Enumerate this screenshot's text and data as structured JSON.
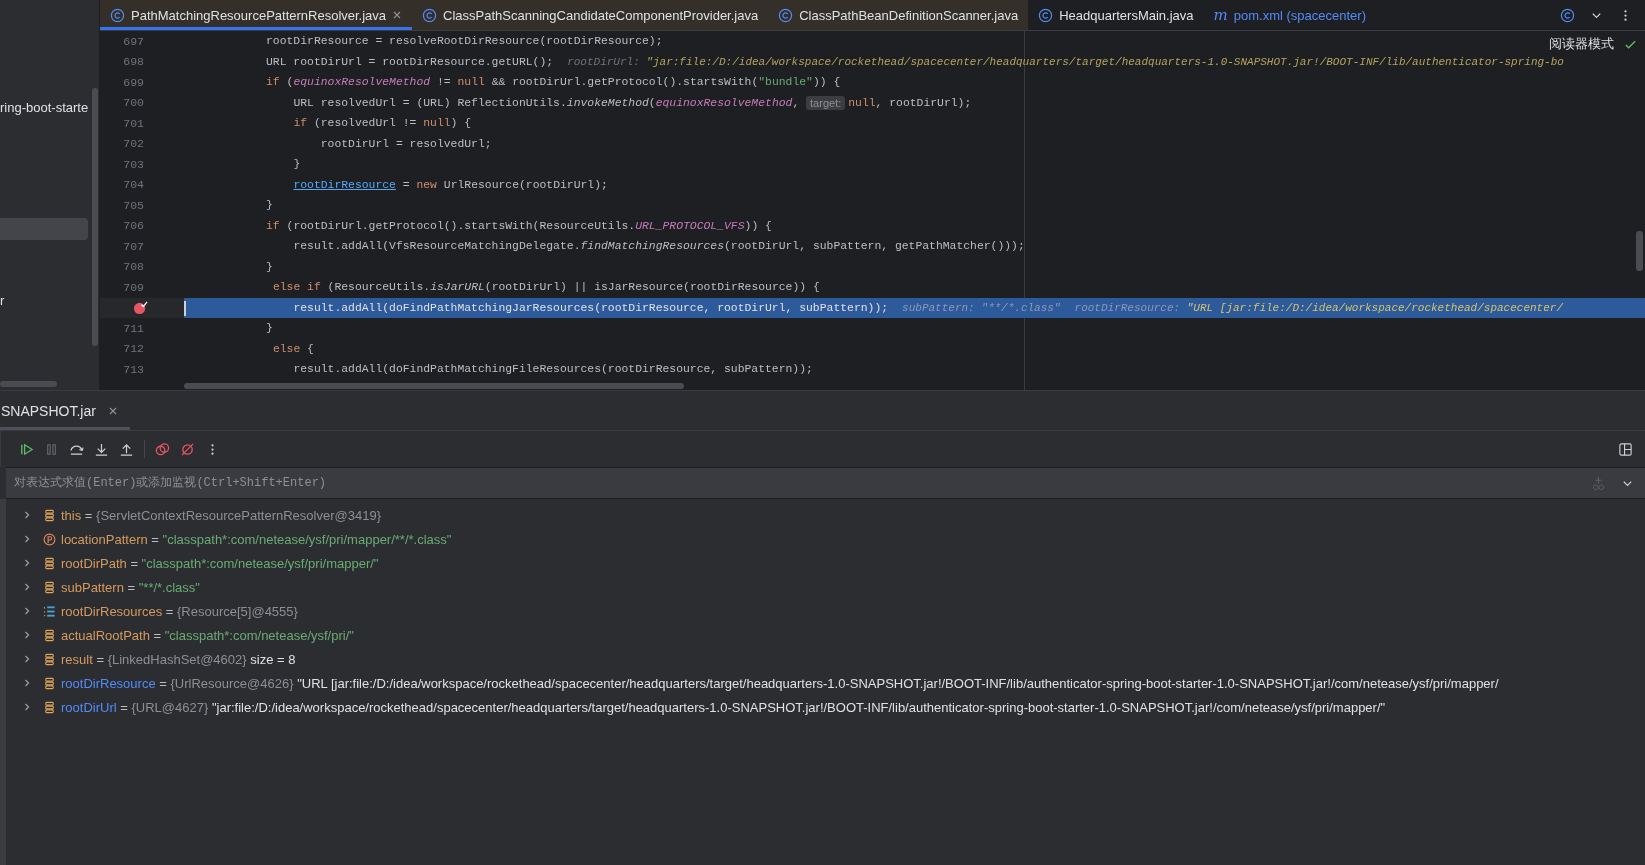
{
  "editor_tabs": [
    {
      "label": "PathMatchingResourcePatternResolver.java",
      "icon": {
        "kind": "class"
      },
      "selected": true,
      "tinted": true,
      "vcs_modified": false,
      "closable": true
    },
    {
      "label": "ClassPathScanningCandidateComponentProvider.java",
      "icon": {
        "kind": "class"
      },
      "selected": false,
      "tinted": true,
      "vcs_modified": false,
      "closable": false
    },
    {
      "label": "ClassPathBeanDefinitionScanner.java",
      "icon": {
        "kind": "class"
      },
      "selected": false,
      "tinted": true,
      "vcs_modified": false,
      "closable": false
    },
    {
      "label": "HeadquartersMain.java",
      "icon": {
        "kind": "class"
      },
      "selected": false,
      "tinted": false,
      "vcs_modified": false,
      "closable": false
    },
    {
      "label": "pom.xml (spacecenter)",
      "icon": {
        "kind": "glyph",
        "glyph": "m"
      },
      "selected": false,
      "tinted": false,
      "vcs_modified": true,
      "closable": false
    }
  ],
  "project_panel": {
    "items": [
      {
        "label": "ring-boot-starte",
        "selected": false
      },
      {
        "selected": true
      },
      {
        "label": "r",
        "selected": false
      }
    ]
  },
  "reader_mode": "阅读器模式",
  "code_lines": [
    {
      "number": "697",
      "segments": [
        {
          "kind": "code",
          "tokens": [
            {
              "kind": "plain",
              "text": "            rootDirResource = resolveRootDirResource(rootDirResource);"
            }
          ]
        }
      ]
    },
    {
      "number": "698",
      "segments": [
        {
          "kind": "code",
          "tokens": [
            {
              "kind": "plain",
              "text": "            URL rootDirUrl = rootDirResource.getURL();"
            }
          ]
        },
        {
          "kind": "value_hint",
          "name": "rootDirUrl:",
          "value": "\"jar:file:/D:/idea/workspace/rockethead/spacecenter/headquarters/target/headquarters-1.0-SNAPSHOT.jar!/BOOT-INF/lib/authenticator-spring-bo",
          "dim": false
        }
      ]
    },
    {
      "number": "699",
      "segments": [
        {
          "kind": "code",
          "tokens": [
            {
              "kind": "keyword",
              "text": "            if"
            },
            {
              "kind": "plain",
              "text": " ("
            },
            {
              "kind": "field",
              "text": "equinoxResolveMethod"
            },
            {
              "kind": "plain",
              "text": " != "
            },
            {
              "kind": "keyword",
              "text": "null"
            },
            {
              "kind": "plain",
              "text": " && rootDirUrl.getProtocol().startsWith("
            },
            {
              "kind": "string",
              "text": "\"bundle\""
            },
            {
              "kind": "plain",
              "text": ")) {"
            }
          ]
        }
      ]
    },
    {
      "number": "700",
      "segments": [
        {
          "kind": "code",
          "tokens": [
            {
              "kind": "plain",
              "text": "                URL resolvedUrl = (URL) ReflectionUtils."
            },
            {
              "kind": "static_call",
              "text": "invokeMethod"
            },
            {
              "kind": "plain",
              "text": "("
            },
            {
              "kind": "field",
              "text": "equinoxResolveMethod"
            },
            {
              "kind": "plain",
              "text": ", "
            }
          ]
        },
        {
          "kind": "param_hint",
          "text": "target:"
        },
        {
          "kind": "code",
          "tokens": [
            {
              "kind": "keyword",
              "text": "null"
            },
            {
              "kind": "plain",
              "text": ", rootDirUrl);"
            }
          ]
        }
      ]
    },
    {
      "number": "701",
      "segments": [
        {
          "kind": "code",
          "tokens": [
            {
              "kind": "keyword",
              "text": "                if"
            },
            {
              "kind": "plain",
              "text": " (resolvedUrl != "
            },
            {
              "kind": "keyword",
              "text": "null"
            },
            {
              "kind": "plain",
              "text": ") {"
            }
          ]
        }
      ]
    },
    {
      "number": "702",
      "segments": [
        {
          "kind": "code",
          "tokens": [
            {
              "kind": "plain",
              "text": "                    rootDirUrl = resolvedUrl;"
            }
          ]
        }
      ]
    },
    {
      "number": "703",
      "segments": [
        {
          "kind": "code",
          "tokens": [
            {
              "kind": "plain",
              "text": "                }"
            }
          ]
        }
      ]
    },
    {
      "number": "704",
      "segments": [
        {
          "kind": "code",
          "tokens": [
            {
              "kind": "link",
              "text": "                rootDirResource"
            },
            {
              "kind": "plain",
              "text": " = "
            },
            {
              "kind": "keyword",
              "text": "new"
            },
            {
              "kind": "plain",
              "text": " UrlResource(rootDirUrl);"
            }
          ]
        }
      ]
    },
    {
      "number": "705",
      "segments": [
        {
          "kind": "code",
          "tokens": [
            {
              "kind": "plain",
              "text": "            }"
            }
          ]
        }
      ]
    },
    {
      "number": "706",
      "segments": [
        {
          "kind": "code",
          "tokens": [
            {
              "kind": "keyword",
              "text": "            if"
            },
            {
              "kind": "plain",
              "text": " (rootDirUrl.getProtocol().startsWith(ResourceUtils."
            },
            {
              "kind": "constant",
              "text": "URL_PROTOCOL_VFS"
            },
            {
              "kind": "plain",
              "text": ")) {"
            }
          ]
        }
      ]
    },
    {
      "number": "707",
      "segments": [
        {
          "kind": "code",
          "tokens": [
            {
              "kind": "plain",
              "text": "                result.addAll(VfsResourceMatchingDelegate."
            },
            {
              "kind": "static_call",
              "text": "findMatchingResources"
            },
            {
              "kind": "plain",
              "text": "(rootDirUrl, subPattern, getPathMatcher()));"
            }
          ]
        }
      ]
    },
    {
      "number": "708",
      "segments": [
        {
          "kind": "code",
          "tokens": [
            {
              "kind": "plain",
              "text": "            }"
            }
          ]
        }
      ]
    },
    {
      "number": "709",
      "segments": [
        {
          "kind": "code",
          "tokens": [
            {
              "kind": "keyword",
              "text": "             else if"
            },
            {
              "kind": "plain",
              "text": " (ResourceUtils."
            },
            {
              "kind": "static_call",
              "text": "isJarURL"
            },
            {
              "kind": "plain",
              "text": "(rootDirUrl) || isJarResource(rootDirResource)) {"
            }
          ]
        }
      ]
    },
    {
      "breakpoint": true,
      "current": true,
      "segments": [
        {
          "kind": "code",
          "tokens": [
            {
              "kind": "plain",
              "text": "                result.addAll(doFindPathMatchingJarResources(rootDirResource, rootDirUrl, subPattern));"
            }
          ]
        },
        {
          "kind": "value_hint",
          "name": "subPattern:",
          "value": "\"**/*.class\"",
          "dim": true
        },
        {
          "kind": "value_hint",
          "name": "rootDirResource:",
          "value": "\"URL [jar:file:/D:/idea/workspace/rockethead/spacecenter/",
          "dim": false
        }
      ]
    },
    {
      "number": "711",
      "segments": [
        {
          "kind": "code",
          "tokens": [
            {
              "kind": "plain",
              "text": "            }"
            }
          ]
        }
      ]
    },
    {
      "number": "712",
      "segments": [
        {
          "kind": "code",
          "tokens": [
            {
              "kind": "keyword",
              "text": "             else"
            },
            {
              "kind": "plain",
              "text": " {"
            }
          ]
        }
      ]
    },
    {
      "number": "713",
      "segments": [
        {
          "kind": "code",
          "tokens": [
            {
              "kind": "plain",
              "text": "                result.addAll(doFindPathMatchingFileResources(rootDirResource, subPattern));"
            }
          ]
        }
      ]
    }
  ],
  "debug_panel": {
    "tab": {
      "label": "SNAPSHOT.jar",
      "selected": true
    },
    "evaluate": {
      "placeholder": "对表达式求值(Enter)或添加监视(Ctrl+Shift+Enter)"
    },
    "variables": [
      {
        "expanded": false,
        "kind": "field",
        "name": "this",
        "name_changed": false,
        "assign": "=",
        "ref": "{ServletContextResourcePatternResolver@3419}"
      },
      {
        "expanded": false,
        "kind": "param",
        "name": "locationPattern",
        "name_changed": false,
        "assign": "=",
        "value": {
          "kind": "string",
          "text": "\"classpath*:com/netease/ysf/pri/mapper/**/*.class\""
        }
      },
      {
        "expanded": false,
        "kind": "field",
        "name": "rootDirPath",
        "name_changed": false,
        "assign": "=",
        "value": {
          "kind": "string",
          "text": "\"classpath*:com/netease/ysf/pri/mapper/\""
        }
      },
      {
        "expanded": false,
        "kind": "field",
        "name": "subPattern",
        "name_changed": false,
        "assign": "=",
        "value": {
          "kind": "string",
          "text": "\"**/*.class\""
        }
      },
      {
        "expanded": false,
        "kind": "array",
        "name": "rootDirResources",
        "name_changed": false,
        "assign": "=",
        "ref": "{Resource[5]@4555}"
      },
      {
        "expanded": false,
        "kind": "field",
        "name": "actualRootPath",
        "name_changed": false,
        "assign": "=",
        "value": {
          "kind": "string",
          "text": "\"classpath*:com/netease/ysf/pri/\""
        }
      },
      {
        "expanded": false,
        "kind": "field",
        "name": "result",
        "name_changed": false,
        "assign": "=",
        "ref": "{LinkedHashSet@4602}",
        "value": {
          "kind": "plain",
          "text": "size = 8"
        }
      },
      {
        "expanded": false,
        "kind": "field",
        "name": "rootDirResource",
        "name_changed": true,
        "assign": "=",
        "ref": "{UrlResource@4626}",
        "value": {
          "kind": "plain",
          "text": "\"URL [jar:file:/D:/idea/workspace/rockethead/spacecenter/headquarters/target/headquarters-1.0-SNAPSHOT.jar!/BOOT-INF/lib/authenticator-spring-boot-starter-1.0-SNAPSHOT.jar!/com/netease/ysf/pri/mapper/"
        }
      },
      {
        "expanded": false,
        "kind": "field",
        "name": "rootDirUrl",
        "name_changed": true,
        "assign": "=",
        "ref": "{URL@4627}",
        "value": {
          "kind": "plain",
          "text": "\"jar:file:/D:/idea/workspace/rockethead/spacecenter/headquarters/target/headquarters-1.0-SNAPSHOT.jar!/BOOT-INF/lib/authenticator-spring-boot-starter-1.0-SNAPSHOT.jar!/com/netease/ysf/pri/mapper/\""
        }
      }
    ]
  }
}
